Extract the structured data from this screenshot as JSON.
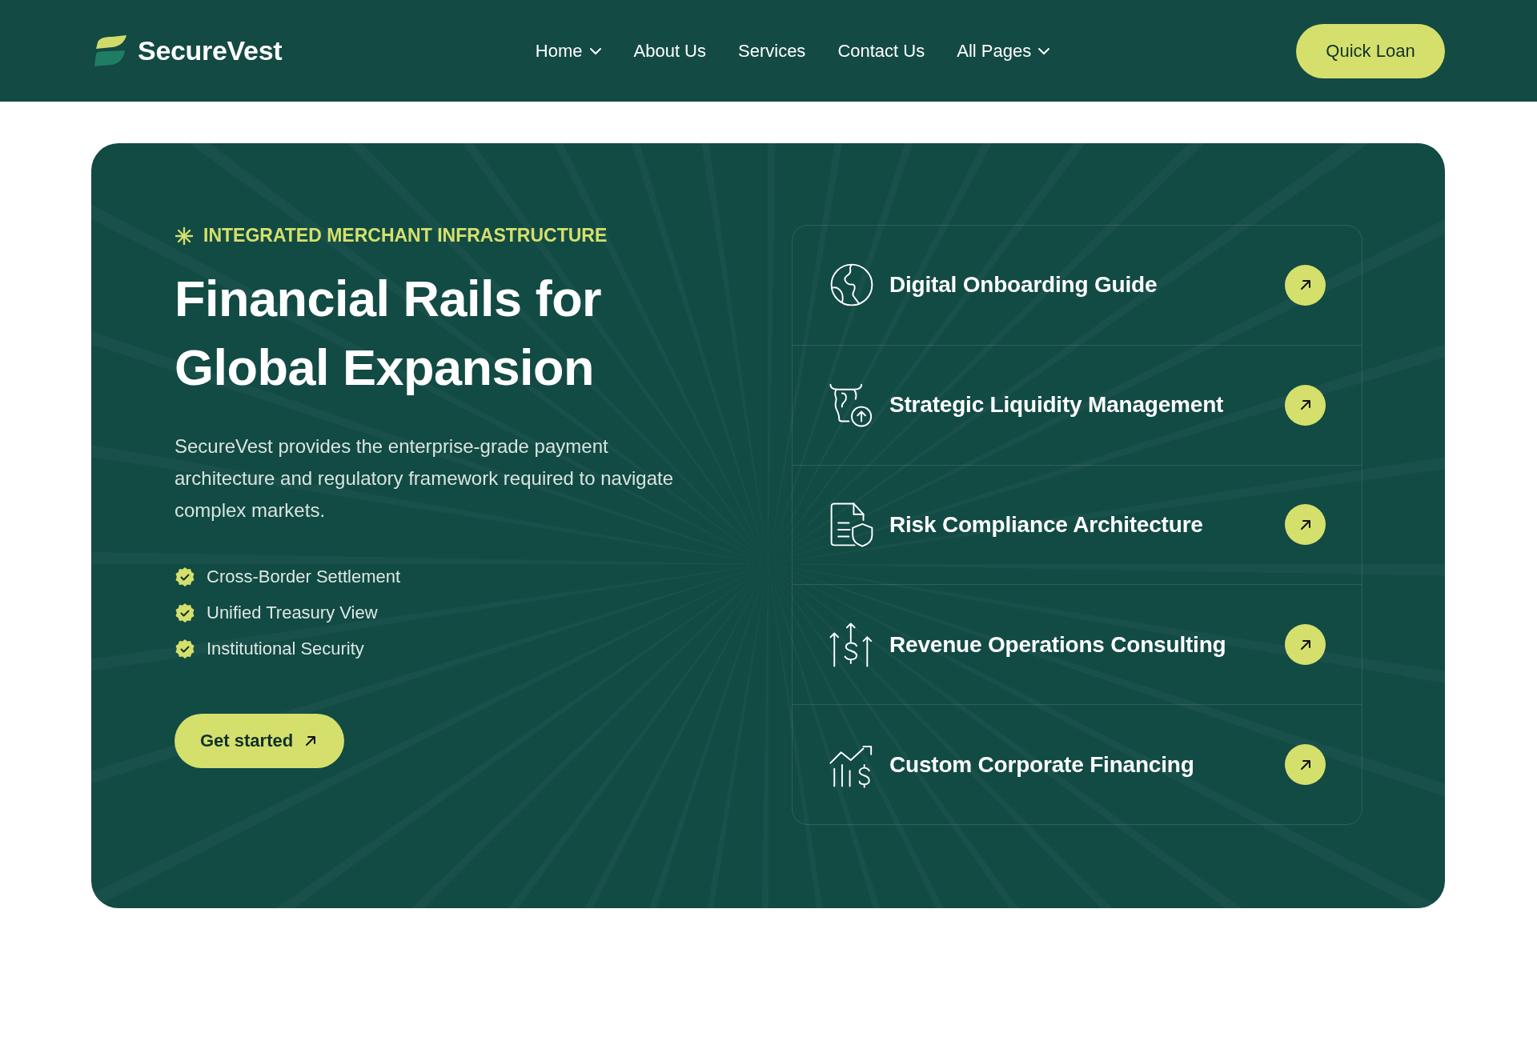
{
  "header": {
    "logo": "SecureVest",
    "nav": [
      {
        "label": "Home",
        "dropdown": true
      },
      {
        "label": "About Us",
        "dropdown": false
      },
      {
        "label": "Services",
        "dropdown": false
      },
      {
        "label": "Contact Us",
        "dropdown": false
      },
      {
        "label": "All Pages",
        "dropdown": true
      }
    ],
    "cta": "Quick Loan"
  },
  "hero": {
    "eyebrow": "INTEGRATED MERCHANT INFRASTRUCTURE",
    "title": "Financial Rails for Global Expansion",
    "description": "SecureVest provides the enterprise-grade payment architecture and regulatory framework required to navigate complex markets.",
    "features": [
      "Cross-Border Settlement",
      "Unified Treasury View",
      "Institutional Security"
    ],
    "button": "Get started"
  },
  "services": [
    {
      "title": "Digital Onboarding Guide"
    },
    {
      "title": "Strategic Liquidity Management"
    },
    {
      "title": "Risk Compliance Architecture"
    },
    {
      "title": "Revenue Operations Consulting"
    },
    {
      "title": "Custom Corporate Financing"
    }
  ]
}
